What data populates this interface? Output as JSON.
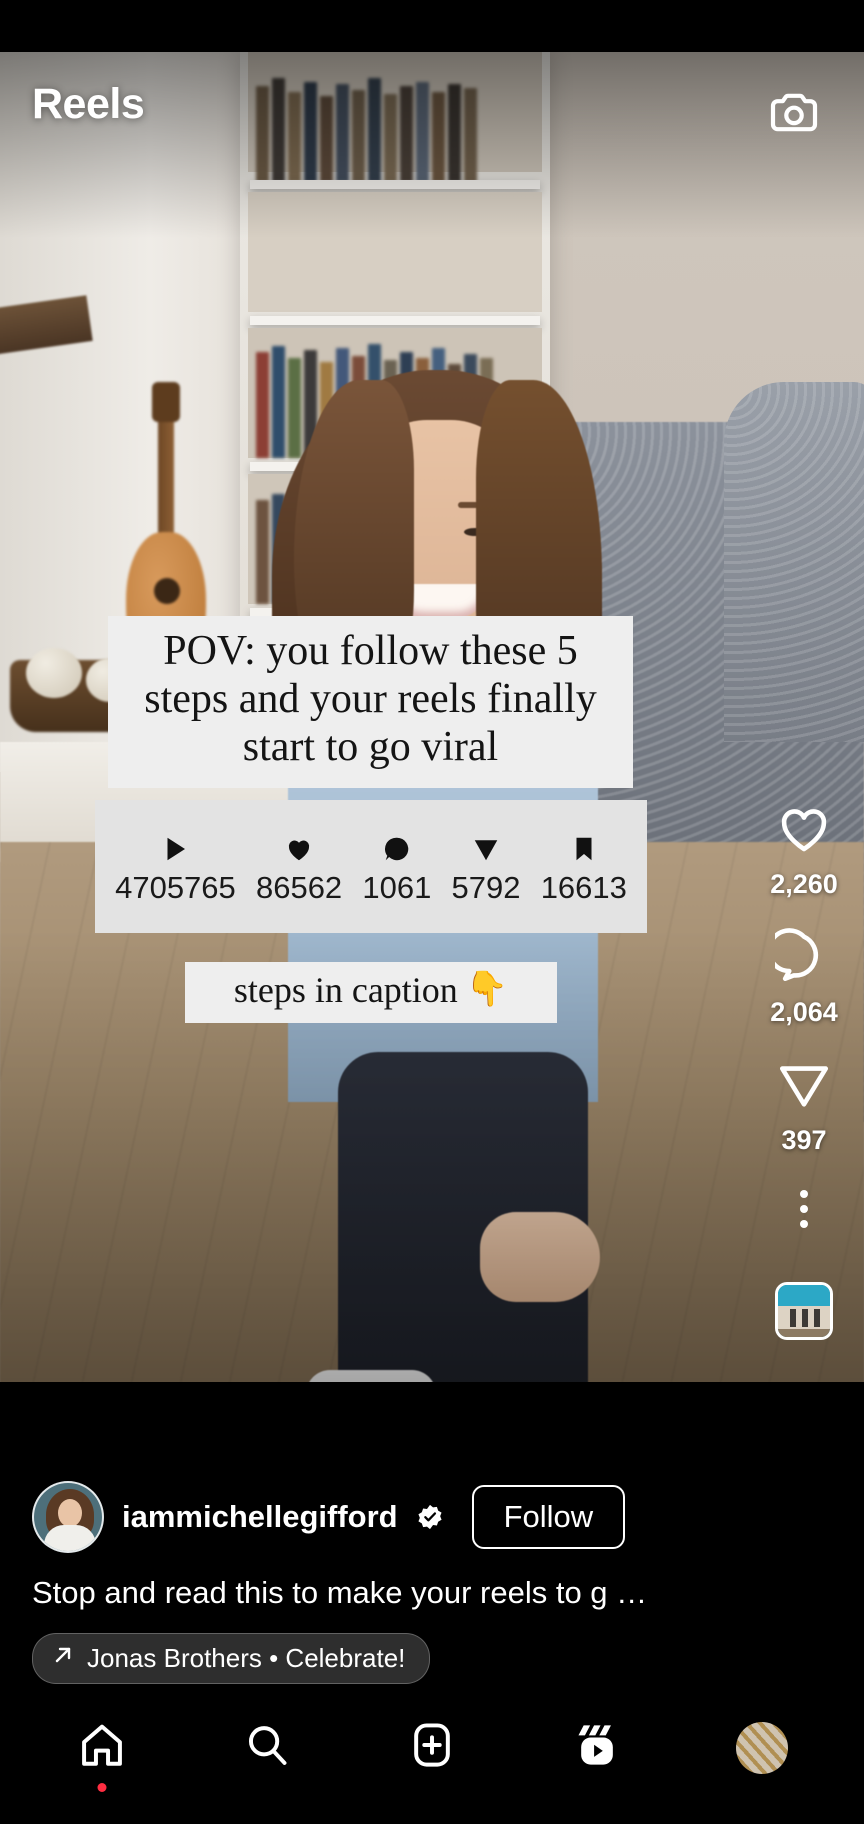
{
  "header": {
    "title": "Reels",
    "camera_icon": "camera-icon"
  },
  "video_overlay": {
    "title_text": "POV: you follow these 5 steps and your reels finally start to go viral",
    "stats": [
      {
        "icon": "play-icon",
        "value": "4705765"
      },
      {
        "icon": "heart-icon",
        "value": "86562"
      },
      {
        "icon": "comment-icon",
        "value": "1061"
      },
      {
        "icon": "share-icon",
        "value": "5792"
      },
      {
        "icon": "bookmark-icon",
        "value": "16613"
      }
    ],
    "caption_card": "steps in caption",
    "caption_card_pointer": "👇"
  },
  "action_rail": {
    "like": {
      "icon": "heart-outline-icon",
      "count": "2,260"
    },
    "comment": {
      "icon": "comment-outline-icon",
      "count": "2,064"
    },
    "share": {
      "icon": "send-outline-icon",
      "count": "397"
    },
    "more": {
      "icon": "more-vertical-icon"
    },
    "audio_thumbnail": "audio-cover-thumbnail"
  },
  "post": {
    "username": "iammichellegifford",
    "verified_icon": "verified-badge-icon",
    "follow_label": "Follow",
    "caption": "Stop and read this to make your reels to g …",
    "audio": {
      "icon": "audio-arrow-icon",
      "label": "Jonas Brothers • Celebrate!"
    }
  },
  "bottom_nav": [
    {
      "name": "home",
      "icon": "home-icon",
      "active": true,
      "badge": true
    },
    {
      "name": "search",
      "icon": "search-icon",
      "active": false,
      "badge": false
    },
    {
      "name": "create",
      "icon": "plus-box-icon",
      "active": false,
      "badge": false
    },
    {
      "name": "reels",
      "icon": "reels-icon",
      "active": true,
      "badge": false
    },
    {
      "name": "profile",
      "icon": "avatar-icon",
      "active": false,
      "badge": false
    }
  ],
  "colors": {
    "accent_red": "#ff2d41",
    "text_white": "#ffffff",
    "overlay_card": "#eeeeee"
  }
}
